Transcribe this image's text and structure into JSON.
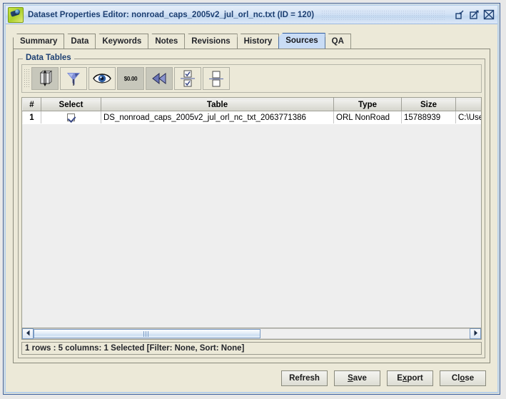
{
  "window": {
    "title": "Dataset Properties Editor: nonroad_caps_2005v2_jul_orl_nc.txt (ID = 120)",
    "app_icon": "dataset-editor-icon",
    "controls": [
      {
        "name": "minimize-button",
        "icon": "minimize-icon"
      },
      {
        "name": "maximize-button",
        "icon": "maximize-icon"
      },
      {
        "name": "close-button",
        "icon": "close-icon"
      }
    ]
  },
  "tabs": [
    {
      "label": "Summary",
      "selected": false
    },
    {
      "label": "Data",
      "selected": false
    },
    {
      "label": "Keywords",
      "selected": false
    },
    {
      "label": "Notes",
      "selected": false
    },
    {
      "label": "Revisions",
      "selected": false
    },
    {
      "label": "History",
      "selected": false
    },
    {
      "label": "Sources",
      "selected": true
    },
    {
      "label": "QA",
      "selected": false
    }
  ],
  "group": {
    "title": "Data Tables"
  },
  "toolbar": {
    "buttons": [
      {
        "name": "sort-columns-button",
        "icon": "column-sort-icon",
        "pressed": true
      },
      {
        "name": "filter-button",
        "icon": "funnel-icon",
        "pressed": false
      },
      {
        "name": "show-hide-columns-button",
        "icon": "eye-icon",
        "pressed": false
      },
      {
        "name": "format-button",
        "icon": "money-format-icon",
        "label": "$0.00",
        "pressed": true
      },
      {
        "name": "reset-button",
        "icon": "rewind-icon",
        "pressed": true
      },
      {
        "name": "select-all-button",
        "icon": "check-all-icon",
        "pressed": false
      },
      {
        "name": "clear-selection-button",
        "icon": "split-boxes-icon",
        "pressed": false
      }
    ]
  },
  "table": {
    "columns": [
      "#",
      "Select",
      "Table",
      "Type",
      "Size",
      ""
    ],
    "rows": [
      {
        "num": "1",
        "selected": true,
        "table": "DS_nonroad_caps_2005v2_jul_orl_nc_txt_2063771386",
        "type": "ORL NonRoad",
        "size": "15788939",
        "path": "C:\\Users\\cse"
      }
    ]
  },
  "status": {
    "text": "1 rows : 5 columns: 1 Selected [Filter: None, Sort: None]"
  },
  "buttons": [
    {
      "name": "refresh-button",
      "label": "Refresh",
      "mnemonic": ""
    },
    {
      "name": "save-button",
      "label": "Save",
      "mnemonic": "S"
    },
    {
      "name": "export-button",
      "label": "Export",
      "mnemonic": "x"
    },
    {
      "name": "close-dialog-button",
      "label": "Close",
      "mnemonic": "o"
    }
  ],
  "colors": {
    "title_text": "#1c3f72",
    "panel": "#ece9d8",
    "selected_tab": "#c9dcf5",
    "grid_empty": "#eeeeee"
  }
}
